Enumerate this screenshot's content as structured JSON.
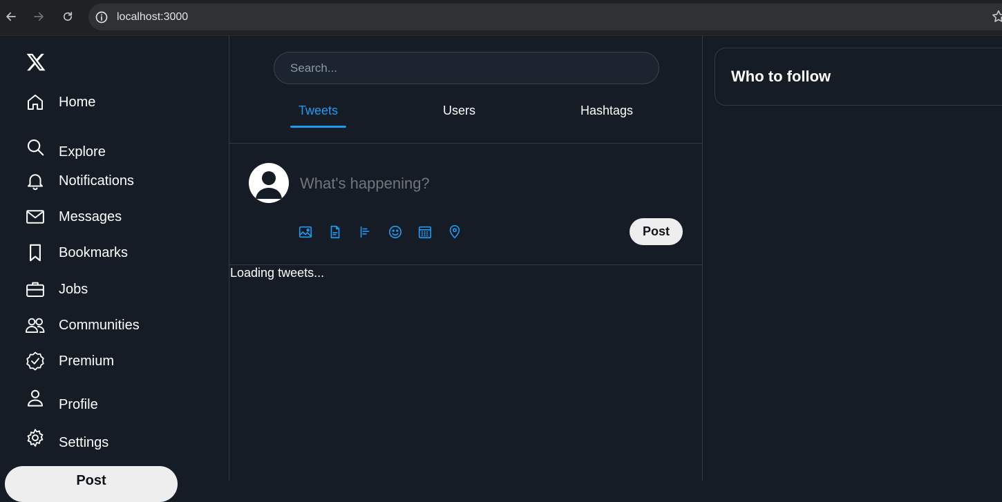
{
  "browser": {
    "url": "localhost:3000"
  },
  "sidebar": {
    "logo": "x-logo-icon",
    "items": [
      {
        "label": "Home",
        "icon": "home-icon"
      },
      {
        "label": "Explore",
        "icon": "search-icon"
      },
      {
        "label": "Notifications",
        "icon": "bell-icon"
      },
      {
        "label": "Messages",
        "icon": "mail-icon"
      },
      {
        "label": "Bookmarks",
        "icon": "bookmark-icon"
      },
      {
        "label": "Jobs",
        "icon": "briefcase-icon"
      },
      {
        "label": "Communities",
        "icon": "people-icon"
      },
      {
        "label": "Premium",
        "icon": "verified-badge-icon"
      },
      {
        "label": "Profile",
        "icon": "person-icon"
      },
      {
        "label": "Settings",
        "icon": "gear-icon"
      }
    ],
    "post_label": "Post"
  },
  "main": {
    "search": {
      "placeholder": "Search..."
    },
    "tabs": [
      {
        "label": "Tweets",
        "active": true
      },
      {
        "label": "Users",
        "active": false
      },
      {
        "label": "Hashtags",
        "active": false
      }
    ],
    "composer": {
      "placeholder": "What's happening?",
      "tools": [
        "image-icon",
        "gif-icon",
        "poll-icon",
        "emoji-icon",
        "schedule-icon",
        "location-icon"
      ],
      "post_label": "Post"
    },
    "status": "Loading tweets..."
  },
  "right": {
    "who_to_follow_title": "Who to follow"
  },
  "colors": {
    "background": "#151c26",
    "accent": "#1d9bf0",
    "border": "#2f3b47"
  }
}
